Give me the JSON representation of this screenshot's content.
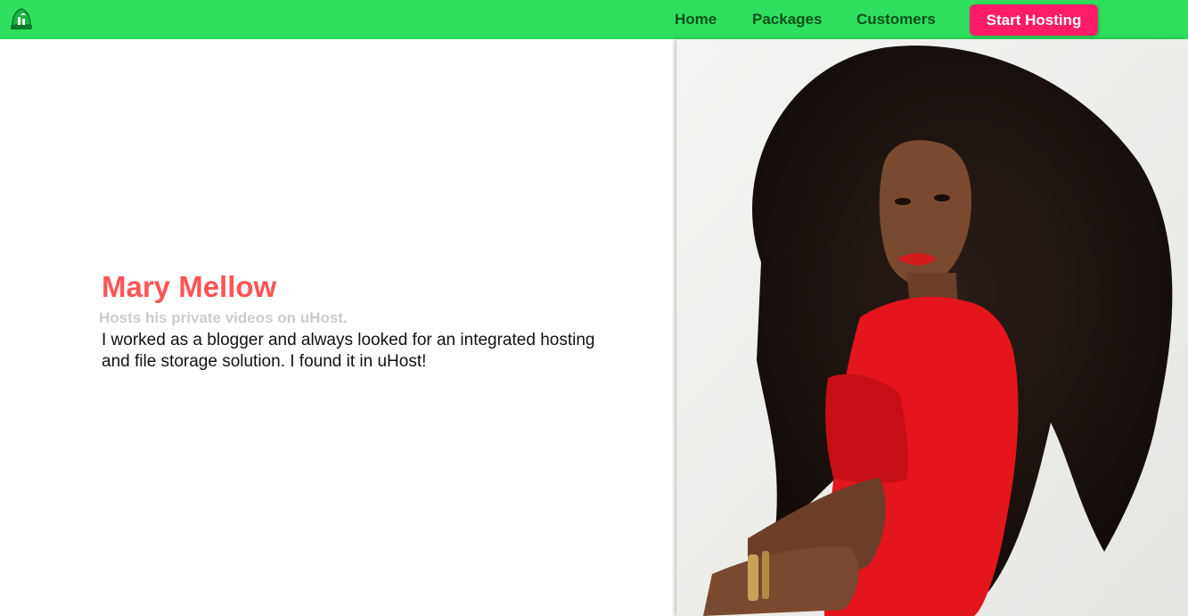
{
  "header": {
    "logo_icon": "uhost-logo-icon",
    "nav": {
      "home": "Home",
      "packages": "Packages",
      "customers": "Customers"
    },
    "cta_label": "Start Hosting"
  },
  "testimonial": {
    "name": "Mary Mellow",
    "subtitle": "Hosts his private videos on uHost.",
    "quote": "I worked as a blogger and always looked for an integrated hosting and file storage solution. I found it in uHost!"
  },
  "colors": {
    "header_bg": "#2ddf5c",
    "nav_text": "#0e4f1f",
    "cta_bg": "#ff1b68",
    "name": "#ff5454",
    "subtitle": "#cccccc"
  }
}
